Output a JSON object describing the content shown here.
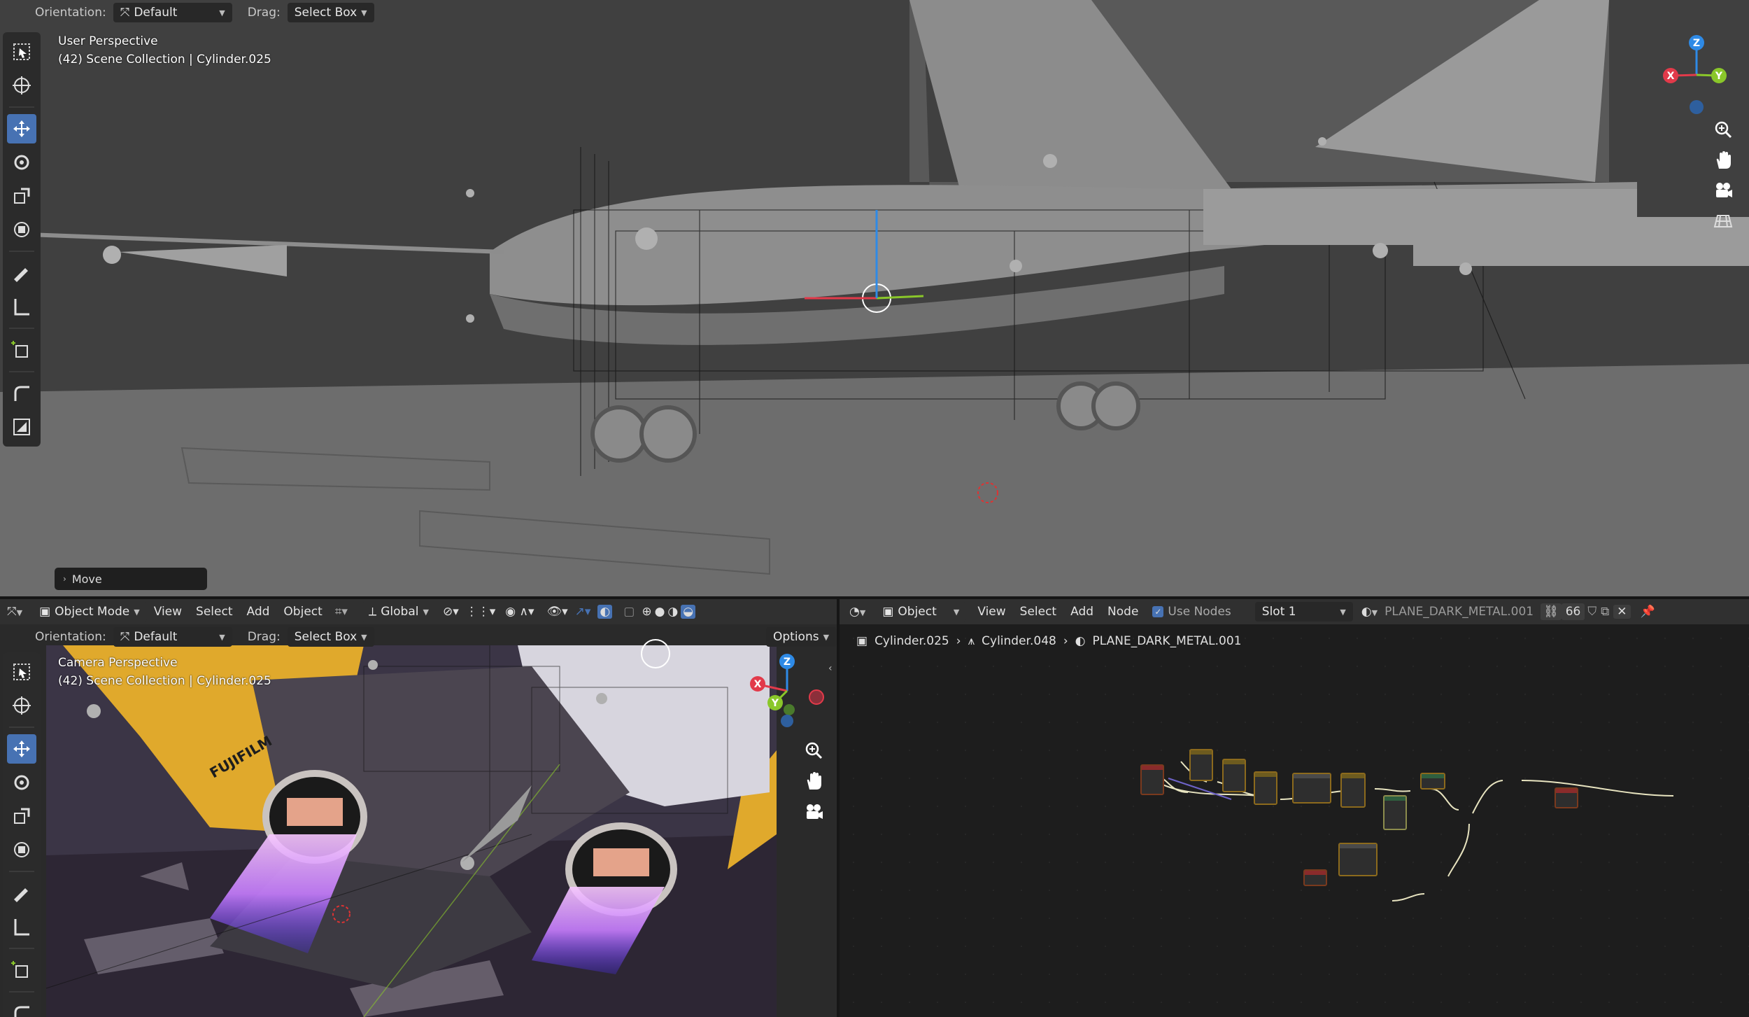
{
  "top_header": {
    "orientation_label": "Orientation:",
    "orientation_value": "Default",
    "drag_label": "Drag:",
    "drag_value": "Select Box"
  },
  "top_viewport": {
    "view_name": "User Perspective",
    "collection_info": "(42) Scene Collection | Cylinder.025",
    "last_operator": "Move"
  },
  "bottom_left_header": {
    "mode": "Object Mode",
    "menus": [
      "View",
      "Select",
      "Add",
      "Object"
    ],
    "transform_space": "Global",
    "orientation_label": "Orientation:",
    "orientation_value": "Default",
    "drag_label": "Drag:",
    "drag_value": "Select Box",
    "options_label": "Options"
  },
  "camera_viewport": {
    "view_name": "Camera Perspective",
    "collection_info": "(42) Scene Collection | Cylinder.025",
    "decal_text": "FUJIFILM"
  },
  "node_editor_header": {
    "object_selector": "Object",
    "menus": [
      "View",
      "Select",
      "Add",
      "Node"
    ],
    "use_nodes_label": "Use Nodes",
    "slot": "Slot 1",
    "material_name": "PLANE_DARK_METAL.001",
    "users_count": "66"
  },
  "breadcrumb": {
    "object": "Cylinder.025",
    "mesh": "Cylinder.048",
    "material": "PLANE_DARK_METAL.001"
  },
  "axis_labels": {
    "x": "X",
    "y": "Y",
    "z": "Z"
  },
  "colors": {
    "accent": "#4772b3",
    "axis_x": "#e23a4a",
    "axis_y": "#8ac72a",
    "axis_z": "#2e8ae6"
  },
  "icons": {
    "tools": [
      "select-box-icon",
      "cursor-icon",
      "move-icon",
      "rotate-icon",
      "scale-icon",
      "transform-icon",
      "annotate-icon",
      "measure-icon",
      "add-cube-icon",
      "extrude-icon",
      "inset-icon"
    ],
    "nav": [
      "zoom-icon",
      "pan-hand-icon",
      "camera-icon",
      "grid-icon"
    ]
  }
}
